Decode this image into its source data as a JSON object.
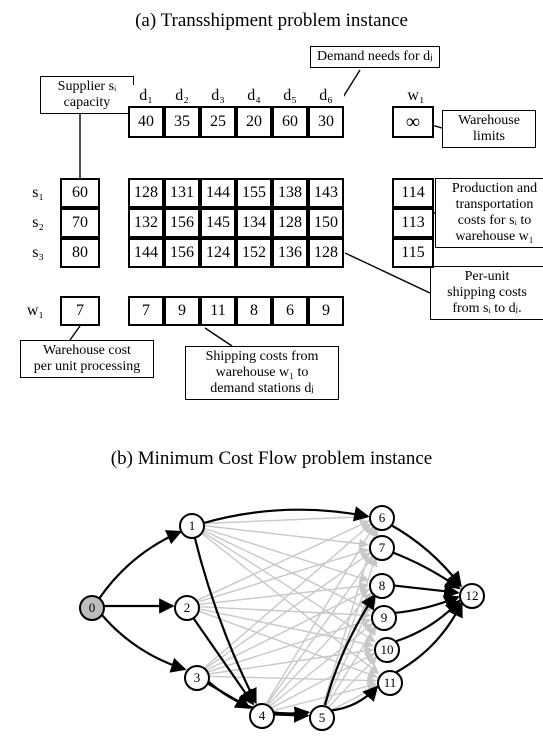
{
  "titles": {
    "a": "(a) Transshipment problem instance",
    "b": "(b) Minimum Cost Flow problem instance"
  },
  "d_headers": [
    "d₁",
    "d₂",
    "d₃",
    "d₄",
    "d₅",
    "d₆"
  ],
  "w_header": "w₁",
  "demand_needs": [
    40,
    35,
    25,
    20,
    60,
    30
  ],
  "warehouse_limit": "∞",
  "s_headers": [
    "s₁",
    "s₂",
    "s₃"
  ],
  "supply_cap": [
    60,
    70,
    80
  ],
  "ship_cost": [
    [
      128,
      131,
      144,
      155,
      138,
      143
    ],
    [
      132,
      156,
      145,
      134,
      128,
      150
    ],
    [
      144,
      156,
      124,
      152,
      136,
      128
    ]
  ],
  "s_to_w": [
    114,
    113,
    115
  ],
  "w_row_header": "w₁",
  "w_proc_cost": 7,
  "w_to_d": [
    7,
    9,
    11,
    8,
    6,
    9
  ],
  "labels": {
    "supplier_cap": "Supplier sᵢ\ncapacity",
    "demand_needs": "Demand needs for dⱼ",
    "warehouse_limits": "Warehouse\nlimits",
    "prod_trans": "Production and\ntransportation\ncosts for sᵢ to\nwarehouse w₁",
    "per_unit": "Per-unit\nshipping costs\nfrom sᵢ to dⱼ.",
    "w_proc": "Warehouse cost\nper unit processing",
    "w_to_d": "Shipping costs from\nwarehouse w₁ to\ndemand stations dⱼ"
  },
  "chart_data": {
    "type": "table",
    "description": "Transshipment problem data and corresponding min-cost-flow graph",
    "suppliers": [
      "s1",
      "s2",
      "s3"
    ],
    "supply_capacity": {
      "s1": 60,
      "s2": 70,
      "s3": 80
    },
    "demands": [
      "d1",
      "d2",
      "d3",
      "d4",
      "d5",
      "d6"
    ],
    "demand_needs": {
      "d1": 40,
      "d2": 35,
      "d3": 25,
      "d4": 20,
      "d5": 60,
      "d6": 30
    },
    "warehouse": {
      "name": "w1",
      "limit": "infinity",
      "per_unit_processing_cost": 7
    },
    "ship_cost_s_to_d": {
      "s1": [
        128,
        131,
        144,
        155,
        138,
        143
      ],
      "s2": [
        132,
        156,
        145,
        134,
        128,
        150
      ],
      "s3": [
        144,
        156,
        124,
        152,
        136,
        128
      ]
    },
    "cost_s_to_w1": {
      "s1": 114,
      "s2": 113,
      "s3": 115
    },
    "cost_w1_to_d": {
      "d1": 7,
      "d2": 9,
      "d3": 11,
      "d4": 8,
      "d5": 6,
      "d6": 9
    },
    "graph_nodes": [
      0,
      1,
      2,
      3,
      4,
      5,
      6,
      7,
      8,
      9,
      10,
      11,
      12
    ],
    "graph_strong_edges": [
      [
        0,
        1
      ],
      [
        0,
        2
      ],
      [
        0,
        3
      ],
      [
        1,
        4
      ],
      [
        2,
        4
      ],
      [
        3,
        4
      ],
      [
        3,
        5
      ],
      [
        4,
        5
      ],
      [
        5,
        8
      ],
      [
        5,
        11
      ],
      [
        1,
        6
      ],
      [
        6,
        12
      ],
      [
        7,
        12
      ],
      [
        8,
        12
      ],
      [
        9,
        12
      ],
      [
        10,
        12
      ],
      [
        11,
        12
      ]
    ],
    "graph_light_edges": "all sᵢ→dⱼ and w→dⱼ shipping arcs"
  }
}
